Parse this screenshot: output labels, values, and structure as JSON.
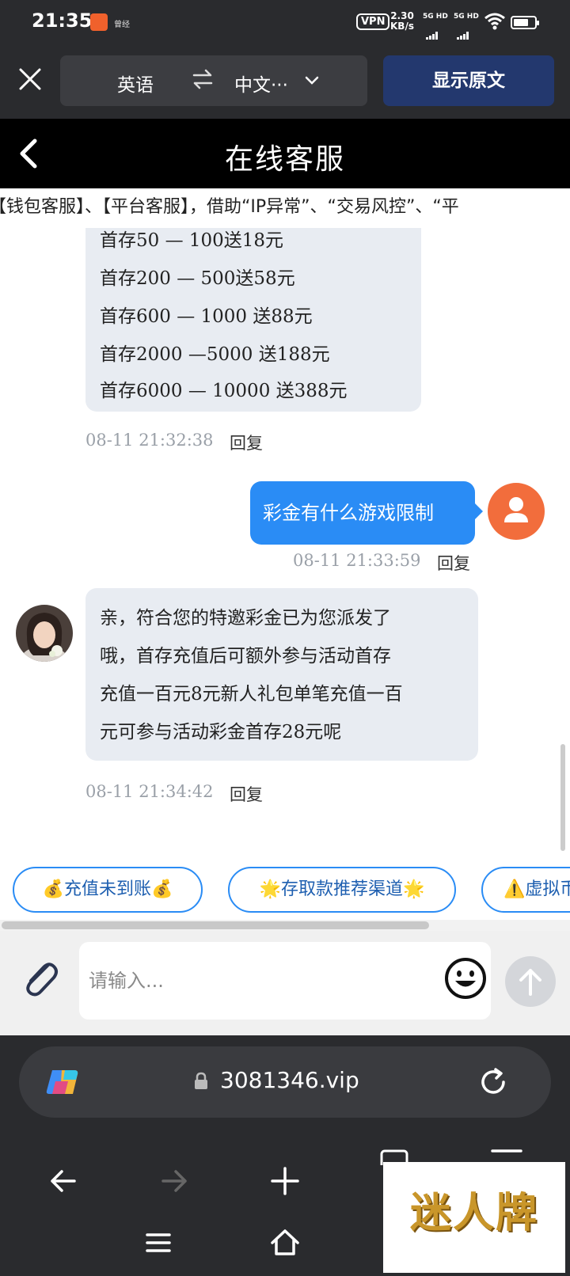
{
  "status_bar": {
    "time": "21:35",
    "tiny_text": "曾经",
    "vpn": "VPN",
    "speed_value": "2.30",
    "speed_unit": "KB/s",
    "sim1": "5G HD",
    "sim2": "5G HD"
  },
  "translate_bar": {
    "source_lang": "英语",
    "target_lang": "中文···",
    "show_original": "显示原文"
  },
  "header": {
    "title": "在线客服"
  },
  "marquee": "【钱包客服】、【平台客服】，借助“IP异常”、“交易风控”、“平",
  "chat": {
    "promo_lines": [
      "首存50 — 100送18元",
      "首存200 — 500送58元",
      "首存600 — 1000 送88元",
      "首存2000 —5000 送188元",
      "首存6000 — 10000 送388元"
    ],
    "promo_time": "08-11 21:32:38",
    "reply_label": "回复",
    "user_message": "彩金有什么游戏限制",
    "user_time": "08-11 21:33:59",
    "agent_lines": [
      "亲，符合您的特邀彩金已为您派发了",
      "哦，首存充值后可额外参与活动首存",
      "充值一百元8元新人礼包单笔充值一百",
      "元可参与活动彩金首存28元呢"
    ],
    "agent_time": "08-11 21:34:42"
  },
  "quick_replies": [
    "💰充值未到账💰",
    "🌟存取款推荐渠道🌟",
    "⚠️虚拟币"
  ],
  "input": {
    "placeholder": "请输入..."
  },
  "browser": {
    "url": "3081346.vip"
  },
  "watermark": "迷人牌",
  "colors": {
    "accent": "#2a8cf5",
    "user_avatar": "#f26d3c",
    "dark_bar": "#2a2b2e",
    "translate_button": "#23386e"
  }
}
